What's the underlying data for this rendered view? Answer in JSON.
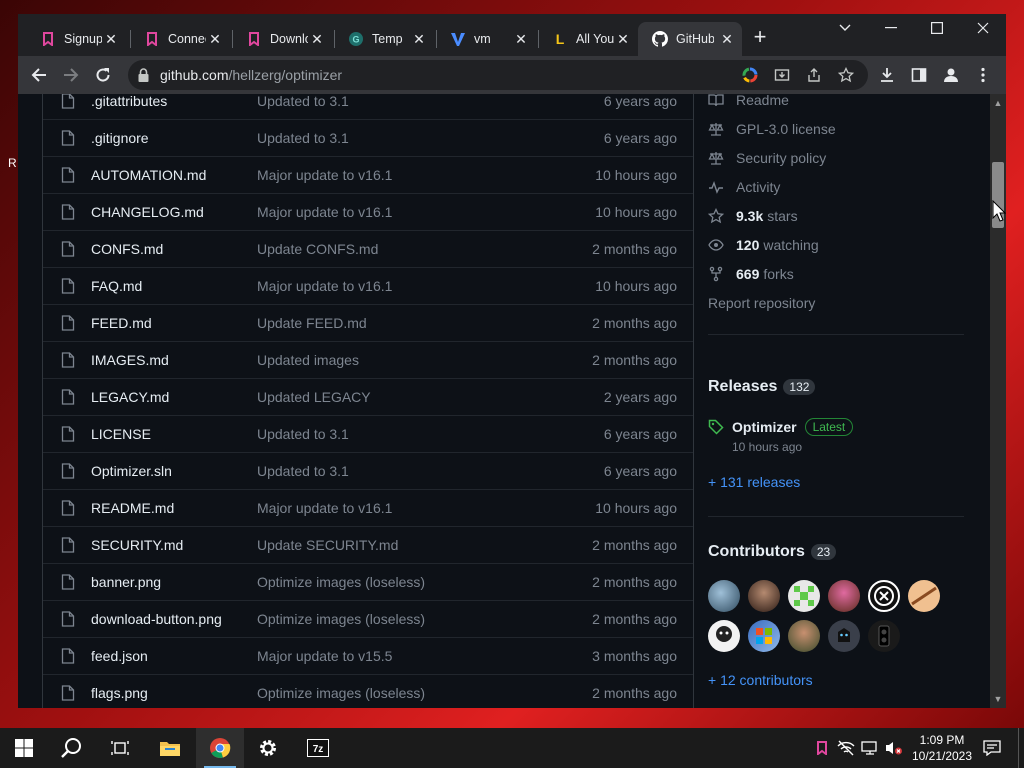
{
  "browser": {
    "tabs": [
      {
        "label": "Signup",
        "icon": "bookmark-icon",
        "color": "#e0479e"
      },
      {
        "label": "Connect",
        "icon": "bookmark-icon",
        "color": "#e0479e"
      },
      {
        "label": "Download",
        "icon": "bookmark-icon",
        "color": "#e0479e"
      },
      {
        "label": "Temp",
        "icon": "template-icon",
        "color": "#20b2aa"
      },
      {
        "label": "vm",
        "icon": "v-logo-icon",
        "color": "#4a8cff"
      },
      {
        "label": "All You",
        "icon": "l-logo-icon",
        "color": "#f5c518",
        "letter": "L"
      },
      {
        "label": "GitHub",
        "icon": "github-icon",
        "color": "#ffffff"
      }
    ],
    "url_domain": "github.com",
    "url_path": "/hellzerg/optimizer"
  },
  "files": [
    {
      "name": ".gitattributes",
      "message": "Updated to 3.1",
      "age": "6 years ago"
    },
    {
      "name": ".gitignore",
      "message": "Updated to 3.1",
      "age": "6 years ago"
    },
    {
      "name": "AUTOMATION.md",
      "message": "Major update to v16.1",
      "age": "10 hours ago"
    },
    {
      "name": "CHANGELOG.md",
      "message": "Major update to v16.1",
      "age": "10 hours ago"
    },
    {
      "name": "CONFS.md",
      "message": "Update CONFS.md",
      "age": "2 months ago"
    },
    {
      "name": "FAQ.md",
      "message": "Major update to v16.1",
      "age": "10 hours ago"
    },
    {
      "name": "FEED.md",
      "message": "Update FEED.md",
      "age": "2 months ago"
    },
    {
      "name": "IMAGES.md",
      "message": "Updated images",
      "age": "2 months ago"
    },
    {
      "name": "LEGACY.md",
      "message": "Updated LEGACY",
      "age": "2 years ago"
    },
    {
      "name": "LICENSE",
      "message": "Updated to 3.1",
      "age": "6 years ago"
    },
    {
      "name": "Optimizer.sln",
      "message": "Updated to 3.1",
      "age": "6 years ago"
    },
    {
      "name": "README.md",
      "message": "Major update to v16.1",
      "age": "10 hours ago"
    },
    {
      "name": "SECURITY.md",
      "message": "Update SECURITY.md",
      "age": "2 months ago"
    },
    {
      "name": "banner.png",
      "message": "Optimize images (loseless)",
      "age": "2 months ago"
    },
    {
      "name": "download-button.png",
      "message": "Optimize images (loseless)",
      "age": "2 months ago"
    },
    {
      "name": "feed.json",
      "message": "Major update to v15.5",
      "age": "3 months ago"
    },
    {
      "name": "flags.png",
      "message": "Optimize images (loseless)",
      "age": "2 months ago"
    }
  ],
  "about": {
    "readme": "Readme",
    "license": "GPL-3.0 license",
    "security": "Security policy",
    "activity": "Activity",
    "stars_count": "9.3k",
    "stars_label": "stars",
    "watching_count": "120",
    "watching_label": "watching",
    "forks_count": "669",
    "forks_label": "forks",
    "report": "Report repository"
  },
  "releases": {
    "title": "Releases",
    "count": "132",
    "latest_name": "Optimizer",
    "latest_badge": "Latest",
    "latest_time": "10 hours ago",
    "more_link": "+ 131 releases"
  },
  "contributors": {
    "title": "Contributors",
    "count": "23",
    "more_link": "+ 12 contributors"
  },
  "taskbar": {
    "time": "1:09 PM",
    "date": "10/21/2023"
  },
  "desktop": {
    "partial_text": "R"
  }
}
